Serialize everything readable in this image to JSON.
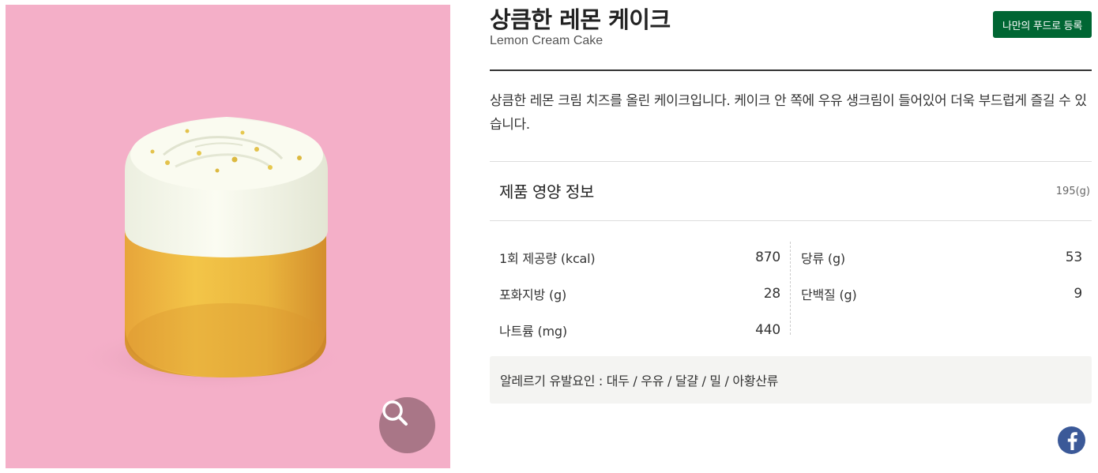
{
  "product": {
    "title_ko": "상큼한 레몬 케이크",
    "title_en": "Lemon Cream Cake",
    "register_button_label": "나만의 푸드로 등록",
    "description": "상큼한 레몬 크림 치즈를 올린 케이크입니다. 케이크 안 쪽에 우유 생크림이 들어있어 더욱 부드럽게 즐길 수 있습니다."
  },
  "image": {
    "background_color": "#f4afc8",
    "subject": "lemon-cream-cake",
    "zoom_icon": "search-icon"
  },
  "nutrition": {
    "title": "제품 영양 정보",
    "serving_size": "195(g)",
    "left": [
      {
        "label": "1회 제공량 (kcal)",
        "value": "870"
      },
      {
        "label": "포화지방 (g)",
        "value": "28"
      },
      {
        "label": "나트륨 (mg)",
        "value": "440"
      }
    ],
    "right": [
      {
        "label": "당류 (g)",
        "value": "53"
      },
      {
        "label": "단백질 (g)",
        "value": "9"
      }
    ]
  },
  "allergy": {
    "text": "알레르기 유발요인 : 대두 / 우유 / 달걀 / 밀 / 아황산류"
  },
  "share": {
    "facebook_icon": "facebook-icon",
    "facebook_color": "#3b5998"
  },
  "colors": {
    "brand_green": "#006633"
  }
}
